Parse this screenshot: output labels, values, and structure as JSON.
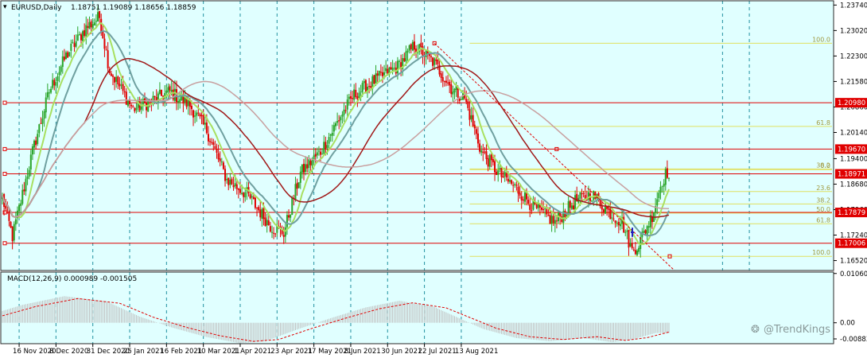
{
  "header": {
    "symbol": "EURUSD,Daily",
    "ohlc": "1.18751 1.19089 1.18656 1.18859"
  },
  "macd_header": "MACD(12,26,9) 0.000989 -0.001505",
  "watermark": "@TrendKings",
  "colors": {
    "background": "#e0ffff",
    "bull": "#28a428",
    "bear": "#e00000",
    "ma_fast": "#a8e060",
    "ma_mid": "#6fa0a0",
    "ma_slow": "#a01818",
    "ma_long": "#c8a0a0",
    "hline": "#e00000",
    "fib": "#e0e060",
    "grid": "#2090a0",
    "macd_hist": "#c0c0c0",
    "macd_signal": "#e00000"
  },
  "chart_data": {
    "type": "candlestick",
    "y_axis_ticks": [
      "1.23740",
      "1.23020",
      "1.22300",
      "1.21580",
      "1.20860",
      "1.20140",
      "1.19400",
      "1.18680",
      "1.17960",
      "1.17240",
      "1.16520"
    ],
    "ylim": [
      1.1624,
      1.2386
    ],
    "x_axis_ticks": [
      "16 Nov 2020",
      "8 Dec 2020",
      "31 Dec 2020",
      "25 Jan 2021",
      "16 Feb 2021",
      "10 Mar 2021",
      "1 Apr 2021",
      "23 Apr 2021",
      "17 May 2021",
      "8 Jun 2021",
      "30 Jun 2021",
      "22 Jul 2021",
      "13 Aug 2021"
    ],
    "price_levels": [
      {
        "value": 1.2098,
        "label": "1.20980"
      },
      {
        "value": 1.1967,
        "label": "1.19670"
      },
      {
        "value": 1.1897,
        "label": "1.18971",
        "current": true
      },
      {
        "value": 1.1788,
        "label": "1.17879"
      },
      {
        "value": 1.1701,
        "label": "1.17006"
      }
    ],
    "fib_upper": [
      {
        "label": "100.0",
        "value": 1.2266
      },
      {
        "label": "61.8",
        "value": 1.2031
      },
      {
        "label": "38.2",
        "value": 1.1911
      }
    ],
    "fib_lower": [
      {
        "label": "0.0",
        "value": 1.1909
      },
      {
        "label": "23.6",
        "value": 1.1847
      },
      {
        "label": "38.2",
        "value": 1.1812
      },
      {
        "label": "50.0",
        "value": 1.1786
      },
      {
        "label": "61.8",
        "value": 1.1756
      },
      {
        "label": "100.0",
        "value": 1.1664
      }
    ],
    "anchors": [
      [
        0,
        1.183
      ],
      [
        6,
        1.172
      ],
      [
        18,
        1.196
      ],
      [
        28,
        1.213
      ],
      [
        38,
        1.223
      ],
      [
        50,
        1.231
      ],
      [
        58,
        1.234
      ],
      [
        64,
        1.219
      ],
      [
        78,
        1.208
      ],
      [
        88,
        1.21
      ],
      [
        100,
        1.213
      ],
      [
        112,
        1.209
      ],
      [
        122,
        1.202
      ],
      [
        134,
        1.188
      ],
      [
        146,
        1.184
      ],
      [
        160,
        1.175
      ],
      [
        168,
        1.173
      ],
      [
        178,
        1.19
      ],
      [
        190,
        1.196
      ],
      [
        202,
        1.206
      ],
      [
        210,
        1.212
      ],
      [
        222,
        1.216
      ],
      [
        236,
        1.22
      ],
      [
        246,
        1.226
      ],
      [
        258,
        1.221
      ],
      [
        268,
        1.214
      ],
      [
        276,
        1.211
      ],
      [
        286,
        1.196
      ],
      [
        296,
        1.19
      ],
      [
        306,
        1.186
      ],
      [
        318,
        1.18
      ],
      [
        330,
        1.176
      ],
      [
        342,
        1.182
      ],
      [
        352,
        1.184
      ],
      [
        362,
        1.179
      ],
      [
        370,
        1.176
      ],
      [
        376,
        1.168
      ],
      [
        380,
        1.17
      ],
      [
        388,
        1.178
      ],
      [
        394,
        1.188
      ],
      [
        398,
        1.191
      ]
    ],
    "macd": {
      "ylim": [
        -0.0045,
        0.0109
      ],
      "ticks": [
        "0.010600",
        "0.00",
        "-0.008837"
      ],
      "signal_anchors": [
        [
          0,
          0.0015
        ],
        [
          20,
          0.0035
        ],
        [
          45,
          0.0052
        ],
        [
          70,
          0.0042
        ],
        [
          90,
          0.0012
        ],
        [
          110,
          -0.001
        ],
        [
          130,
          -0.0028
        ],
        [
          150,
          -0.004
        ],
        [
          165,
          -0.0036
        ],
        [
          185,
          -0.0012
        ],
        [
          205,
          0.001
        ],
        [
          225,
          0.003
        ],
        [
          245,
          0.0043
        ],
        [
          265,
          0.0032
        ],
        [
          280,
          0.001
        ],
        [
          295,
          -0.0012
        ],
        [
          315,
          -0.003
        ],
        [
          335,
          -0.0036
        ],
        [
          355,
          -0.003
        ],
        [
          372,
          -0.0038
        ],
        [
          385,
          -0.0032
        ],
        [
          398,
          -0.002
        ]
      ]
    }
  }
}
